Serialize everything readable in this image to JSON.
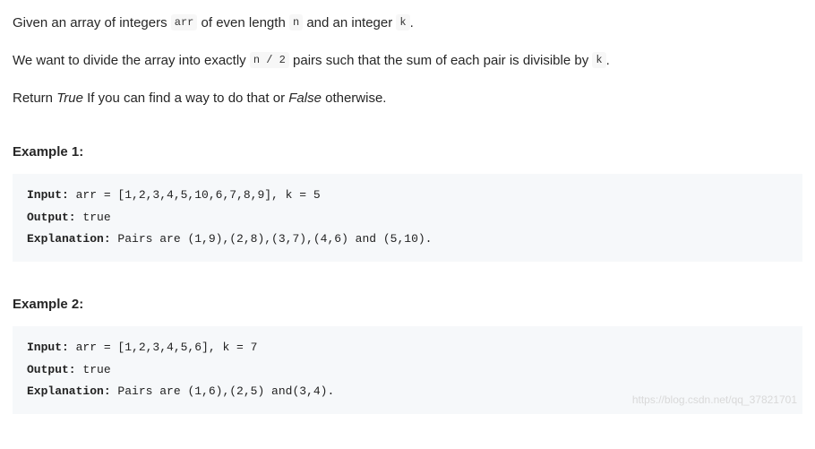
{
  "intro": {
    "p1_a": "Given an array of integers ",
    "p1_code_arr": "arr",
    "p1_b": " of even length ",
    "p1_code_n": "n",
    "p1_c": " and an integer ",
    "p1_code_k": "k",
    "p1_d": ".",
    "p2_a": "We want to divide the array into exactly ",
    "p2_code_half": "n /  2",
    "p2_b": " pairs such that the sum of each pair is divisible by ",
    "p2_code_k": "k",
    "p2_c": ".",
    "p3_a": "Return ",
    "p3_true": "True",
    "p3_b": " If you can find a way to do that or ",
    "p3_false": "False",
    "p3_c": " otherwise."
  },
  "ex1": {
    "heading": "Example 1:",
    "input_label": "Input:",
    "input_text": " arr = [1,2,3,4,5,10,6,7,8,9], k = 5",
    "output_label": "Output:",
    "output_text": " true",
    "expl_label": "Explanation:",
    "expl_text": " Pairs are (1,9),(2,8),(3,7),(4,6) and (5,10)."
  },
  "ex2": {
    "heading": "Example 2:",
    "input_label": "Input:",
    "input_text": " arr = [1,2,3,4,5,6], k = 7",
    "output_label": "Output:",
    "output_text": " true",
    "expl_label": "Explanation:",
    "expl_text": " Pairs are (1,6),(2,5) and(3,4).",
    "watermark": "https://blog.csdn.net/qq_37821701"
  }
}
